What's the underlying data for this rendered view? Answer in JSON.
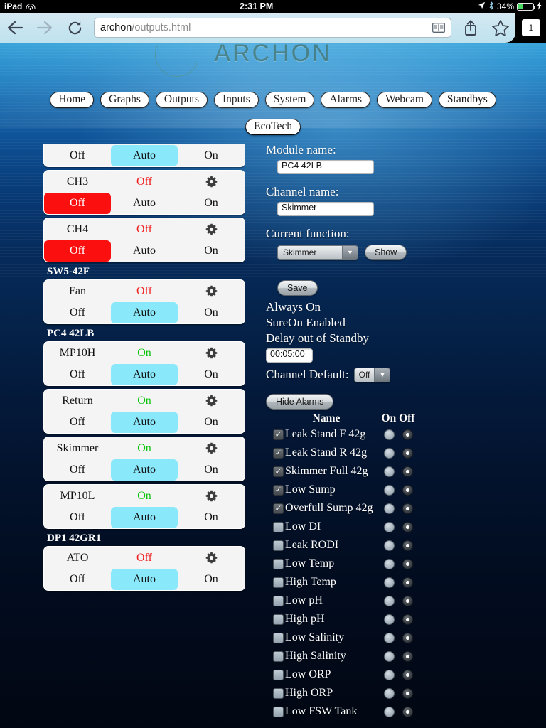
{
  "status_bar": {
    "device": "iPad",
    "wifi_icon": "wifi-icon",
    "time": "2:31 PM",
    "location_icon": "location-arrow-icon",
    "bluetooth_icon": "bluetooth-icon",
    "battery_percent": "34%",
    "battery_icon": "battery-icon",
    "charging_icon": "lightning-bolt-icon"
  },
  "browser": {
    "back_icon": "back-arrow-icon",
    "forward_icon": "forward-arrow-icon",
    "reload_icon": "reload-icon",
    "url_host": "archon",
    "url_path": "/outputs.html",
    "reader_icon": "reader-view-icon",
    "share_icon": "share-icon",
    "bookmark_icon": "star-icon",
    "tab_count": "1"
  },
  "site": {
    "logo_text": "ARCHON",
    "nav_primary": [
      "Home",
      "Graphs",
      "Outputs",
      "Inputs",
      "System",
      "Alarms",
      "Webcam",
      "Standbys"
    ],
    "nav_secondary": [
      "EcoTech"
    ]
  },
  "channels": [
    {
      "type": "channel",
      "name": "",
      "state": "",
      "state_class": "",
      "partial_top": true,
      "gear_icon": "gear-icon",
      "buttons": [
        {
          "label": "Off",
          "selected": false
        },
        {
          "label": "Auto",
          "selected": true
        },
        {
          "label": "On",
          "selected": false
        }
      ]
    },
    {
      "type": "channel",
      "name": "CH3",
      "state": "Off",
      "state_class": "off",
      "gear_icon": "gear-icon",
      "buttons": [
        {
          "label": "Off",
          "selected": true
        },
        {
          "label": "Auto",
          "selected": false
        },
        {
          "label": "On",
          "selected": false
        }
      ]
    },
    {
      "type": "channel",
      "name": "CH4",
      "state": "Off",
      "state_class": "off",
      "gear_icon": "gear-icon",
      "buttons": [
        {
          "label": "Off",
          "selected": true
        },
        {
          "label": "Auto",
          "selected": false
        },
        {
          "label": "On",
          "selected": false
        }
      ]
    },
    {
      "type": "group",
      "label": "SW5-42F"
    },
    {
      "type": "channel",
      "name": "Fan",
      "state": "Off",
      "state_class": "off",
      "gear_icon": "gear-icon",
      "buttons": [
        {
          "label": "Off",
          "selected": false
        },
        {
          "label": "Auto",
          "selected": true
        },
        {
          "label": "On",
          "selected": false
        }
      ]
    },
    {
      "type": "group",
      "label": "PC4 42LB"
    },
    {
      "type": "channel",
      "name": "MP10H",
      "state": "On",
      "state_class": "on",
      "gear_icon": "gear-icon",
      "buttons": [
        {
          "label": "Off",
          "selected": false
        },
        {
          "label": "Auto",
          "selected": true
        },
        {
          "label": "On",
          "selected": false
        }
      ]
    },
    {
      "type": "channel",
      "name": "Return",
      "state": "On",
      "state_class": "on",
      "gear_icon": "gear-icon",
      "buttons": [
        {
          "label": "Off",
          "selected": false
        },
        {
          "label": "Auto",
          "selected": true
        },
        {
          "label": "On",
          "selected": false
        }
      ]
    },
    {
      "type": "channel",
      "name": "Skimmer",
      "state": "On",
      "state_class": "on",
      "gear_icon": "gear-icon",
      "buttons": [
        {
          "label": "Off",
          "selected": false
        },
        {
          "label": "Auto",
          "selected": true
        },
        {
          "label": "On",
          "selected": false
        }
      ]
    },
    {
      "type": "channel",
      "name": "MP10L",
      "state": "On",
      "state_class": "on",
      "gear_icon": "gear-icon",
      "buttons": [
        {
          "label": "Off",
          "selected": false
        },
        {
          "label": "Auto",
          "selected": true
        },
        {
          "label": "On",
          "selected": false
        }
      ]
    },
    {
      "type": "group",
      "label": "DP1 42GR1"
    },
    {
      "type": "channel",
      "name": "ATO",
      "state": "Off",
      "state_class": "off",
      "gear_icon": "gear-icon",
      "buttons": [
        {
          "label": "Off",
          "selected": false
        },
        {
          "label": "Auto",
          "selected": true
        },
        {
          "label": "On",
          "selected": false
        }
      ]
    }
  ],
  "detail": {
    "module_name_label": "Module name:",
    "module_name_value": "PC4 42LB",
    "channel_name_label": "Channel name:",
    "channel_name_value": "Skimmer",
    "current_function_label": "Current function:",
    "current_function_value": "Skimmer",
    "show_button": "Show",
    "save_button": "Save",
    "always_on": "Always On",
    "sure_on": "SureOn Enabled",
    "delay_label": "Delay out of Standby",
    "delay_value": "00:05:00",
    "channel_default_label": "Channel Default:",
    "channel_default_value": "Off",
    "hide_alarms_button": "Hide Alarms"
  },
  "alarms": {
    "header_name": "Name",
    "header_onoff": "On Off",
    "rows": [
      {
        "name": "Leak Stand F 42g",
        "checked": true,
        "on_selected": false,
        "off_selected": true
      },
      {
        "name": "Leak Stand R 42g",
        "checked": true,
        "on_selected": false,
        "off_selected": true
      },
      {
        "name": "Skimmer Full 42g",
        "checked": true,
        "on_selected": false,
        "off_selected": true
      },
      {
        "name": "Low Sump",
        "checked": true,
        "on_selected": false,
        "off_selected": true
      },
      {
        "name": "Overfull Sump 42g",
        "checked": true,
        "on_selected": false,
        "off_selected": true
      },
      {
        "name": "Low DI",
        "checked": false,
        "on_selected": false,
        "off_selected": true
      },
      {
        "name": "Leak RODI",
        "checked": false,
        "on_selected": false,
        "off_selected": true
      },
      {
        "name": "Low Temp",
        "checked": false,
        "on_selected": false,
        "off_selected": true
      },
      {
        "name": "High Temp",
        "checked": false,
        "on_selected": false,
        "off_selected": true
      },
      {
        "name": "Low pH",
        "checked": false,
        "on_selected": false,
        "off_selected": true
      },
      {
        "name": "High pH",
        "checked": false,
        "on_selected": false,
        "off_selected": true
      },
      {
        "name": "Low Salinity",
        "checked": false,
        "on_selected": false,
        "off_selected": true
      },
      {
        "name": "High Salinity",
        "checked": false,
        "on_selected": false,
        "off_selected": true
      },
      {
        "name": "Low ORP",
        "checked": false,
        "on_selected": false,
        "off_selected": true
      },
      {
        "name": "High ORP",
        "checked": false,
        "on_selected": false,
        "off_selected": true
      },
      {
        "name": "Low FSW Tank",
        "checked": false,
        "on_selected": false,
        "off_selected": true
      }
    ]
  },
  "colors": {
    "auto_selected": "#8ae8fb",
    "off_selected": "#fb0f0f",
    "state_on": "#0ac20a",
    "state_off": "#f01b1b",
    "battery_green": "#4cd964",
    "logo_teal": "#2b6d76"
  }
}
